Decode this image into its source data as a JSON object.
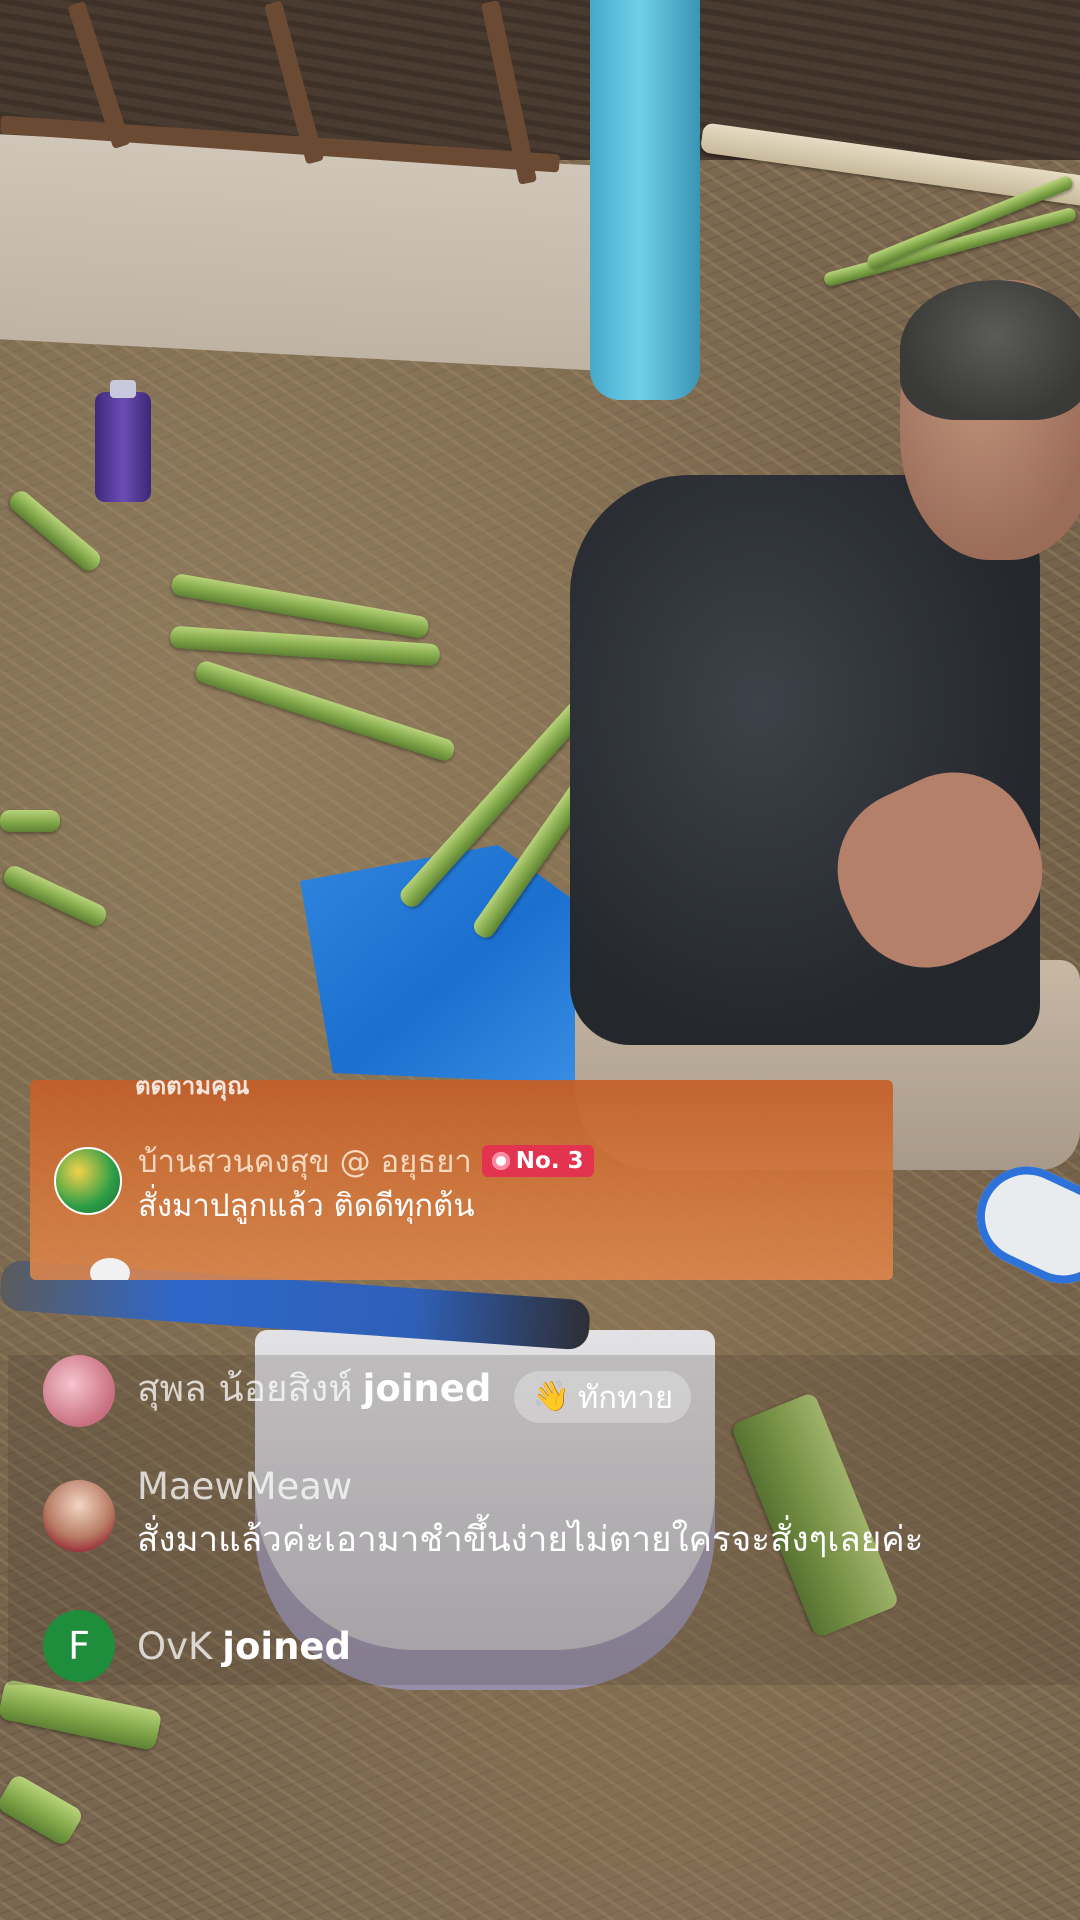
{
  "featured_comment": {
    "cut_off_label": "ติดตามคุณ",
    "user": "บ้านสวนคงสุข @ อยุธยา",
    "rank_badge": "No. 3",
    "text": "สั่งมาปลูกแล้ว ติดดีทุกต้น"
  },
  "chat": {
    "messages": [
      {
        "user": "สุพล น้อยสิงห์",
        "action": "joined",
        "wave_button": "ทักทาย",
        "wave_icon": "waving-hand-icon"
      },
      {
        "user": "MaewMeaw",
        "text": "สั่งมาแล้วค่ะเอามาชำขึ้นง่ายไม่ตายใครจะสั่งๆเลยค่ะ"
      },
      {
        "user": "OvK",
        "action": "joined",
        "avatar_letter": "F",
        "avatar_color": "#1e8d3c"
      }
    ]
  },
  "colors": {
    "featured_bg": "#d0733d",
    "rank_badge": "#e2344f"
  }
}
